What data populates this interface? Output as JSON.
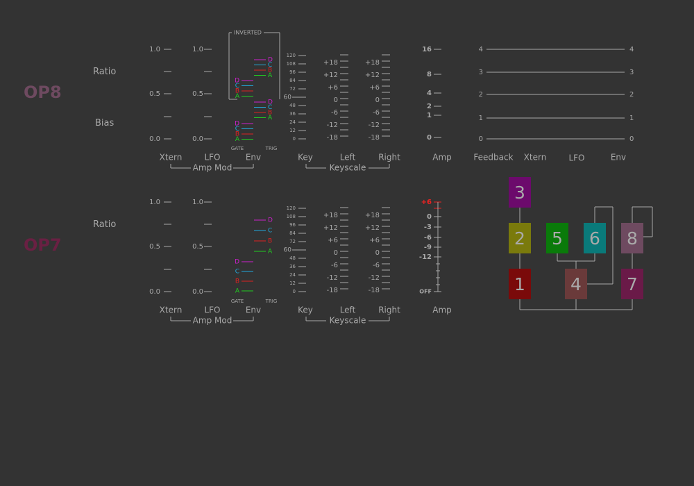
{
  "colors": {
    "background": "#333333",
    "text": "#a9a9a9",
    "op8_label": "#6e4a60",
    "op7_label": "#6a2043",
    "env_a": "#22cc22",
    "env_b": "#dd2222",
    "env_c": "#22aadd",
    "env_d": "#cc22cc",
    "amp_red": "#ee2222"
  },
  "op8": {
    "title": "OP8",
    "ratio_label": "Ratio",
    "bias_label": "Bias",
    "inverted_label": "INVERTED",
    "gate_label": "GATE",
    "trig_label": "TRIG",
    "amp_mod_scale": [
      "1.0",
      "0.5",
      "0.0"
    ],
    "key_scale": [
      "120",
      "108",
      "96",
      "84",
      "72",
      "60",
      "48",
      "36",
      "24",
      "12",
      "0"
    ],
    "key_marker": "60",
    "keyscale_ticks": [
      "+18",
      "+12",
      "+6",
      "0",
      "-6",
      "-12",
      "-18"
    ],
    "amp_scale": [
      "16",
      "8",
      "4",
      "2",
      "1",
      "0"
    ],
    "feedback_scale": [
      "4",
      "3",
      "2",
      "1",
      "0"
    ],
    "env_letters": [
      "D",
      "C",
      "B",
      "A"
    ],
    "columns": {
      "xtern": "Xtern",
      "lfo": "LFO",
      "env": "Env",
      "key": "Key",
      "left": "Left",
      "right": "Right",
      "amp": "Amp",
      "feedback": "Feedback",
      "xtern2": "Xtern",
      "lfo2": "LFO",
      "env2": "Env"
    },
    "group_amp_mod": "Amp Mod",
    "group_keyscale": "Keyscale"
  },
  "op7": {
    "title": "OP7",
    "ratio_label": "Ratio",
    "gate_label": "GATE",
    "trig_label": "TRIG",
    "amp_mod_scale": [
      "1.0",
      "0.5",
      "0.0"
    ],
    "key_scale": [
      "120",
      "108",
      "96",
      "84",
      "72",
      "60",
      "48",
      "36",
      "24",
      "12",
      "0"
    ],
    "key_marker": "60",
    "keyscale_ticks": [
      "+18",
      "+12",
      "+6",
      "0",
      "-6",
      "-12",
      "-18"
    ],
    "amp_scale": [
      "+6",
      "0",
      "-3",
      "-6",
      "-9",
      "-12",
      "OFF"
    ],
    "env_letters": [
      "D",
      "C",
      "B",
      "A"
    ],
    "columns": {
      "xtern": "Xtern",
      "lfo": "LFO",
      "env": "Env",
      "key": "Key",
      "left": "Left",
      "right": "Right",
      "amp": "Amp"
    },
    "group_amp_mod": "Amp Mod",
    "group_keyscale": "Keyscale"
  },
  "algorithm": {
    "ops": [
      {
        "label": "3",
        "color": "#6c0a6c"
      },
      {
        "label": "2",
        "color": "#7a7a0c"
      },
      {
        "label": "5",
        "color": "#0a7a0a"
      },
      {
        "label": "6",
        "color": "#0a7a7a"
      },
      {
        "label": "8",
        "color": "#6e4a60"
      },
      {
        "label": "1",
        "color": "#7a0a0a"
      },
      {
        "label": "4",
        "color": "#6a3a3a"
      },
      {
        "label": "7",
        "color": "#6a1a48"
      }
    ]
  }
}
